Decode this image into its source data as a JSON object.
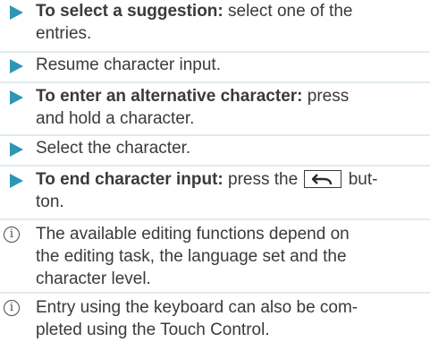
{
  "steps": [
    {
      "bold": "To select a suggestion:",
      "line1": " select one of the",
      "line2": "entries."
    },
    {
      "line1": "Resume character input."
    },
    {
      "bold": "To enter an alternative character:",
      "line1": " press",
      "line2": "and hold a character."
    },
    {
      "line1": "Select the character."
    },
    {
      "bold": "To end character input:",
      "before_key": " press the ",
      "key_icon": "back-arrow-icon",
      "after_key": " but-",
      "line2": "ton."
    }
  ],
  "notes": [
    {
      "icon": "info-icon",
      "glyph": "i",
      "line1": "The available editing functions depend on",
      "line2": "the editing task, the language set and the",
      "line3": "character level."
    },
    {
      "icon": "info-icon",
      "glyph": "i",
      "line1": "Entry using the keyboard can also be com-",
      "line2": "pleted using the Touch Control."
    }
  ],
  "colors": {
    "marker": "#2d96b4",
    "separator": "#e2ecef",
    "text": "#3a3a3a"
  }
}
